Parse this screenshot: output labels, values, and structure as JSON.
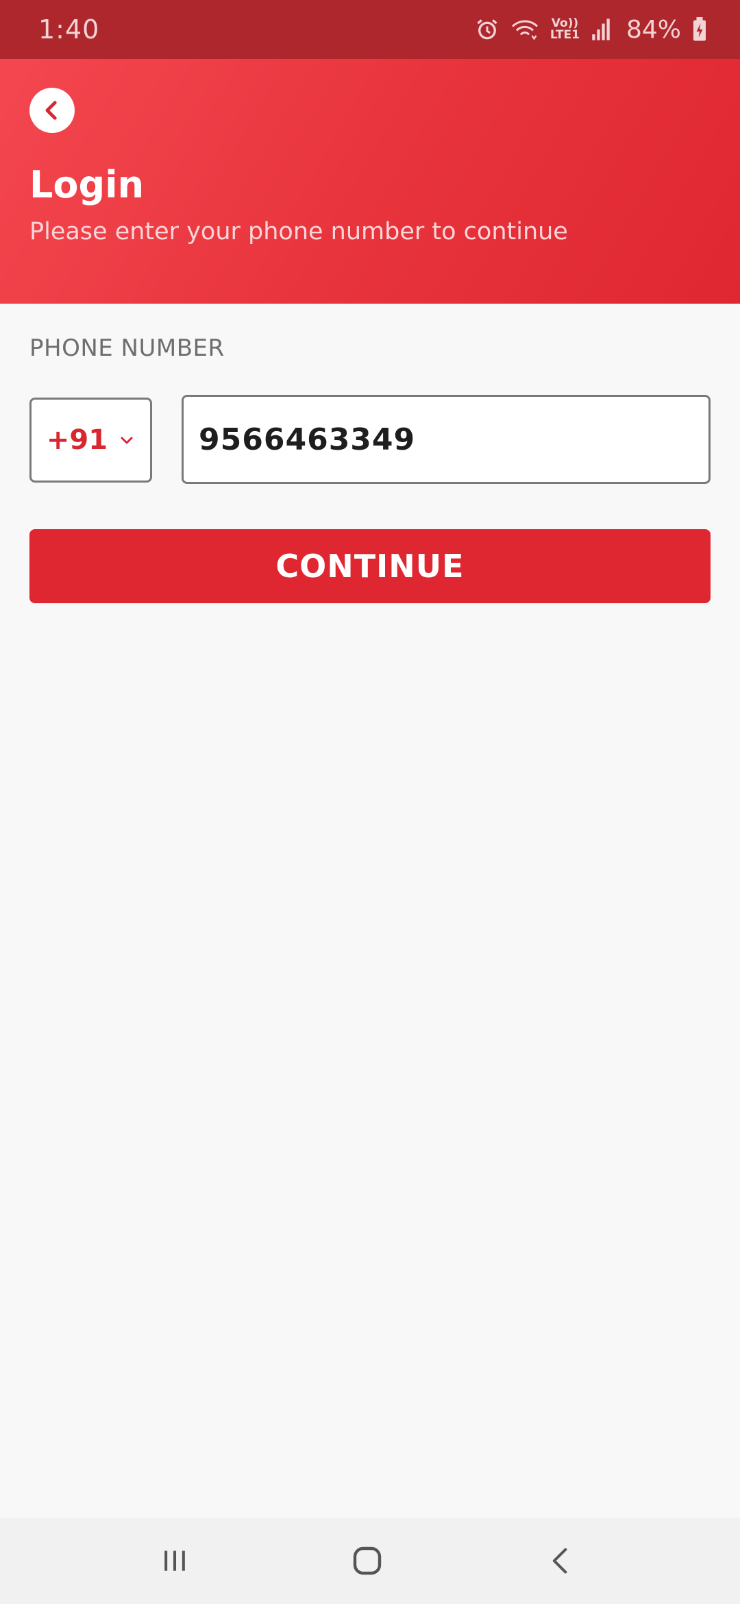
{
  "status_bar": {
    "time": "1:40",
    "network_label_top": "Vo))",
    "network_label_bottom": "LTE1",
    "battery": "84%",
    "icons": [
      "alarm-icon",
      "wifi-icon",
      "volte-icon",
      "signal-icon",
      "battery-charging-icon"
    ]
  },
  "header": {
    "title": "Login",
    "subtitle": "Please enter your phone number to continue",
    "back_icon": "chevron-left-icon",
    "gradient_start": "#f4474f",
    "gradient_end": "#df2731"
  },
  "form": {
    "phone_label": "PHONE NUMBER",
    "country_code": "+91",
    "country_chevron_icon": "chevron-down-icon",
    "phone_value": "9566463349",
    "continue_label": "CONTINUE",
    "accent_color": "#de2731"
  },
  "nav_bar": {
    "icons": [
      "recent-apps-icon",
      "home-icon",
      "back-icon"
    ]
  }
}
